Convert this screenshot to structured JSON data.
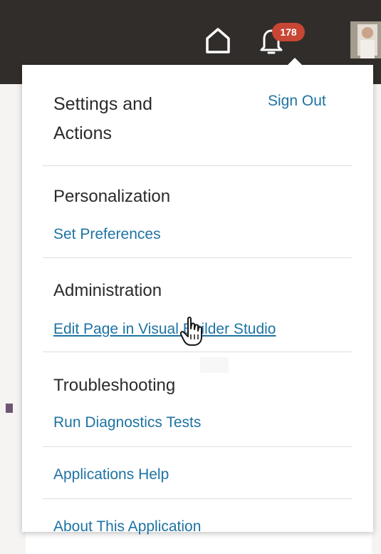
{
  "header": {
    "notification_count": "178",
    "icons": {
      "home": "home-icon",
      "notifications": "bell-icon",
      "avatar": "user-avatar"
    }
  },
  "menu": {
    "title": "Settings and Actions",
    "sign_out": "Sign Out",
    "sections": {
      "personalization": {
        "heading": "Personalization",
        "link": "Set Preferences"
      },
      "administration": {
        "heading": "Administration",
        "link": "Edit Page in Visual Builder Studio"
      },
      "troubleshooting": {
        "heading": "Troubleshooting",
        "link": "Run Diagnostics Tests"
      }
    },
    "applications_help": "Applications Help",
    "about": "About This Application"
  },
  "colors": {
    "header_bg": "#312d2a",
    "link": "#1e73a3",
    "badge": "#c74634"
  }
}
